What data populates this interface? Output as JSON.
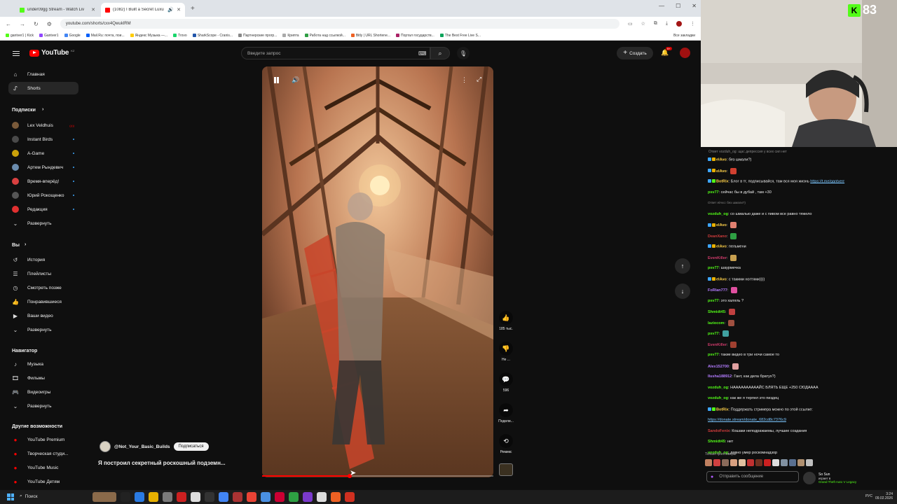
{
  "browser": {
    "tabs": [
      {
        "title": "under09gg Stream - Watch Liv",
        "color": "#53fc18",
        "active": false
      },
      {
        "title": "(1082) I Built a Secret Luxu",
        "color": "#ff0000",
        "active": true
      }
    ],
    "url": "youtube.com/shorts/cxx4QwukIRM",
    "bookmarks": [
      {
        "label": "gantver1 | Kick",
        "color": "#53fc18"
      },
      {
        "label": "Gantver1",
        "color": "#9146ff"
      },
      {
        "label": "Google",
        "color": "#4285f4"
      },
      {
        "label": "Mail.Ru: почта, пои...",
        "color": "#005ff9"
      },
      {
        "label": "Яндекс Музыка —...",
        "color": "#ffcc00"
      },
      {
        "label": "Trovo",
        "color": "#19d66b"
      },
      {
        "label": "SharkScope - Cranis...",
        "color": "#2255aa"
      },
      {
        "label": "Партнерские прогр...",
        "color": "#888888"
      },
      {
        "label": "Крипта",
        "color": "#aaaaaa"
      },
      {
        "label": "Работа над ссылкой...",
        "color": "#2e9e44"
      },
      {
        "label": "Bitly | URL Shortene...",
        "color": "#ee6123"
      },
      {
        "label": "Портал государств...",
        "color": "#aa2266"
      },
      {
        "label": "The Best Free Live S...",
        "color": "#0aa35a"
      }
    ],
    "all_bookmarks": "Все закладки"
  },
  "youtube": {
    "logo": "YouTube",
    "logo_region": "KZ",
    "search_placeholder": "Введите запрос",
    "create_label": "Создать",
    "notification_count": "9+",
    "sidebar": {
      "home": "Главная",
      "shorts": "Shorts",
      "subscriptions_header": "Подписки",
      "subscriptions": [
        {
          "name": "Lex Veldhuis",
          "color": "#7a5a3a",
          "live": true
        },
        {
          "name": "Instant Birds",
          "color": "#4a4a4a",
          "live": false
        },
        {
          "name": "A-Game",
          "color": "#caa10a",
          "live": false
        },
        {
          "name": "Артем Рындевич",
          "color": "#6b8cae",
          "live": false
        },
        {
          "name": "Время-вперёд!",
          "color": "#d94040",
          "live": false
        },
        {
          "name": "Юрий Рокощенко",
          "color": "#555555",
          "live": false
        },
        {
          "name": "Редакция",
          "color": "#e03030",
          "live": false
        }
      ],
      "expand_1": "Развернуть",
      "you_header": "Вы",
      "you_items": [
        "История",
        "Плейлисты",
        "Смотреть позже",
        "Понравившиеся",
        "Ваши видео"
      ],
      "expand_2": "Развернуть",
      "navigator_header": "Навигатор",
      "navigator_items": [
        "Музыка",
        "Фильмы",
        "Видеоигры"
      ],
      "expand_3": "Развернуть",
      "more_header": "Другие возможности",
      "more_items": [
        "YouTube Premium",
        "Творческая студи...",
        "YouTube Music",
        "YouTube Детям"
      ]
    },
    "short": {
      "channel": "@Not_Your_Basic_Builds",
      "subscribe": "Подписаться",
      "title": "Я построил секретный роскошный подземн...",
      "progress": 0.38,
      "actions": {
        "likes": "185 тыс.",
        "dislike": "Не ...",
        "comments": "596",
        "share": "Подели...",
        "remix": "Ремикс"
      }
    }
  },
  "webcam": {
    "kick_viewers": "83"
  },
  "chat": {
    "header": "Ответ vozduh_og: щас депрессия у всех сил нет",
    "messages": [
      {
        "user": "elAvo",
        "color": "#ffd24a",
        "text": "без шмали?)",
        "badges": [
          "#3ea6ff",
          "#e8b100"
        ],
        "emote": null
      },
      {
        "user": "elAvo",
        "color": "#ffd24a",
        "text": "",
        "badges": [
          "#3ea6ff",
          "#e8b100"
        ],
        "emote": "#d04030"
      },
      {
        "user": "BotRix",
        "color": "#ffd24a",
        "text": "Блог в тг, подписывайся, там вся моя жизнь ",
        "link": "https://t.me/gantverr",
        "badges": [
          "#3ea6ff",
          "#53fc18"
        ],
        "emote": null
      },
      {
        "user": "psv77",
        "color": "#53fc18",
        "text": "сейчас бы в дубай , там +30",
        "badges": [],
        "emote": null
      },
      {
        "user": "",
        "color": "#888888",
        "text": "Ответ elAvo: без шмали?)",
        "badges": [],
        "emote": null,
        "reply": true
      },
      {
        "user": "vozduh_og",
        "color": "#53fc18",
        "text": "со шмалью даже и с пивом все равно тяжело",
        "badges": [],
        "emote": null
      },
      {
        "user": "elAvo",
        "color": "#ffd24a",
        "text": "",
        "badges": [
          "#3ea6ff",
          "#e8b100"
        ],
        "emote": "#e08070"
      },
      {
        "user": "DeanXano",
        "color": "#d03c3c",
        "text": "",
        "badges": [],
        "emote": "#2ea043"
      },
      {
        "user": "elAvo",
        "color": "#ffd24a",
        "text": "пельмени",
        "badges": [
          "#3ea6ff",
          "#e8b100"
        ],
        "emote": null
      },
      {
        "user": "EvenKiller",
        "color": "#d03c6c",
        "text": "",
        "badges": [],
        "emote": "#c8a050"
      },
      {
        "user": "psv77",
        "color": "#53fc18",
        "text": "шаурмечка",
        "badges": [],
        "emote": null
      },
      {
        "user": "elAvo",
        "color": "#ffd24a",
        "text": "с такими ногтями))))",
        "badges": [
          "#3ea6ff",
          "#e8b100"
        ],
        "emote": null
      },
      {
        "user": "FoRlan777",
        "color": "#b37cff",
        "text": "",
        "badges": [],
        "emote": "#e050a0"
      },
      {
        "user": "psv77",
        "color": "#53fc18",
        "text": "это халяль ?",
        "badges": [],
        "emote": null
      },
      {
        "user": "Shmidt45",
        "color": "#53fc18",
        "text": "",
        "badges": [],
        "emote": "#c04040"
      },
      {
        "user": "laziocom",
        "color": "#53fc18",
        "text": "",
        "badges": [],
        "emote": "#a05040"
      },
      {
        "user": "psv77",
        "color": "#53fc18",
        "text": "",
        "badges": [],
        "emote": "#40a0a0"
      },
      {
        "user": "EvenKiller",
        "color": "#d03c6c",
        "text": "",
        "badges": [],
        "emote": "#a04030"
      },
      {
        "user": "psv77",
        "color": "#53fc18",
        "text": "такие видео в три ночи самое то",
        "badges": [],
        "emote": null
      },
      {
        "user": "Alex152700",
        "color": "#b37cff",
        "text": "",
        "badges": [],
        "emote": "#e0a0a0"
      },
      {
        "user": "Ilusha188912",
        "color": "#b37cff",
        "text": "Гант, как дела братух?)",
        "badges": [],
        "emote": null
      },
      {
        "user": "vozduh_og",
        "color": "#53fc18",
        "text": "НААААААААААЙС БЛЯТЬ ЕЩЕ +250 СЮДАААА",
        "badges": [],
        "emote": null
      },
      {
        "user": "vozduh_og",
        "color": "#53fc18",
        "text": "как же я терпел это пиздец",
        "badges": [],
        "emote": null
      },
      {
        "user": "BotRix",
        "color": "#ffd24a",
        "text": "Поддержать стримера можно по этой ссылке:",
        "badges": [
          "#3ea6ff",
          "#53fc18"
        ],
        "emote": null
      },
      {
        "user": "",
        "color": "#7cc7ff",
        "text": "",
        "link": "https://donate.stream/donate_682cd8c7376c9",
        "badges": [],
        "emote": null
      },
      {
        "user": "SandoFenix",
        "color": "#d03c3c",
        "text": "Кошаки неподражаемы, лучшие создания",
        "badges": [],
        "emote": null
      },
      {
        "user": "Shmidt45",
        "color": "#53fc18",
        "text": "нет",
        "badges": [],
        "emote": null
      },
      {
        "user": "vozduh_og",
        "color": "#53fc18",
        "text": "давно умер роскомнадзор",
        "badges": [],
        "emote": null
      }
    ],
    "followers_only": "Только фолловеры",
    "emote_colors": [
      "#c08060",
      "#d04040",
      "#8a6a5a",
      "#d8a080",
      "#e0c0a0",
      "#c03030",
      "#703020",
      "#cc2020",
      "#dddddd",
      "#8090a0",
      "#5a7090",
      "#b09070",
      "#c0c0c0"
    ],
    "input_placeholder": "Отправить сообщение",
    "gift": {
      "name": "So Sun",
      "line2": "играет в",
      "line3": "Grand Theft Auto V Legacy"
    }
  },
  "taskbar": {
    "search": "Поиск",
    "tray_lang": "РУС",
    "time": "3:24",
    "date": "09.02.2026"
  }
}
